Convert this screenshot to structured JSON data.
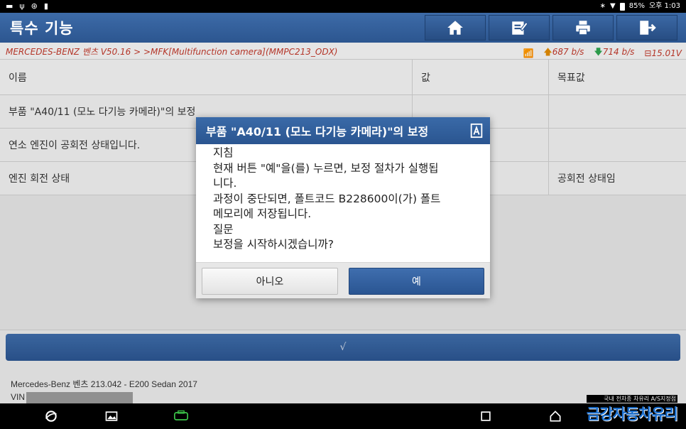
{
  "statusbar": {
    "battery_pct": "85%",
    "time": "오후 1:03"
  },
  "header": {
    "title": "특수 기능",
    "buttons": [
      {
        "icon": "home-icon"
      },
      {
        "icon": "edit-icon"
      },
      {
        "icon": "print-icon"
      },
      {
        "icon": "exit-icon"
      }
    ]
  },
  "breadcrumb": {
    "path": "MERCEDES-BENZ 벤츠 V50.16 > >MFK[Multifunction camera](MMPC213_ODX)",
    "upload_rate": "687 b/s",
    "download_rate": "714 b/s",
    "voltage": "15.01V"
  },
  "table": {
    "headers": [
      "이름",
      "값",
      "목표값"
    ],
    "rows": [
      {
        "name": "부품 \"A40/11 (모노 다기능 카메라)\"의 보정",
        "value": "",
        "target": ""
      },
      {
        "name": "연소 엔진이 공회전 상태입니다.",
        "value": "",
        "target": ""
      },
      {
        "name": "엔진 회전 상태",
        "value": "",
        "target": "공회전 상태임"
      }
    ]
  },
  "checkbar": {
    "label": "√"
  },
  "vehicle": {
    "model": "Mercedes-Benz 벤츠 213.042 - E200 Sedan 2017",
    "vin_label": "VIN"
  },
  "watermark": {
    "small": "국내 전차종 차유리 A/S지정점",
    "big": "금강자동차유리"
  },
  "dialog": {
    "title": "부품 \"A40/11 (모노 다기능 카메라)\"의 보정",
    "lines": [
      "지침",
      "현재 버튼 \"예\"을(를) 누르면, 보정 절차가 실행됩",
      "니다.",
      "과정이 중단되면, 폴트코드 B228600이(가) 폴트",
      "메모리에 저장됩니다.",
      "질문",
      "보정을 시작하시겠습니까?"
    ],
    "no_label": "아니오",
    "yes_label": "예"
  },
  "colors": {
    "accent": "#2c5690",
    "breadcrumb_text": "#c0392b",
    "wifi": "#2ea44f",
    "upload_arrow": "#e08a00"
  }
}
